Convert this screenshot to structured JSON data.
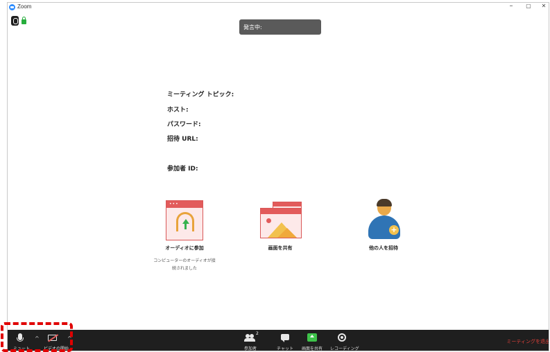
{
  "window": {
    "title": "Zoom"
  },
  "window_controls": {
    "minimize": "–",
    "restore": "▢",
    "close": "✕"
  },
  "notice": {
    "speaking": "発言中:"
  },
  "meeting_info": {
    "topic_label": "ミーティング トピック:",
    "host_label": "ホスト:",
    "password_label": "パスワード:",
    "invite_url_label": "招待 URL:",
    "participant_id_label": "参加者 ID:"
  },
  "actions": {
    "join_audio": {
      "label": "オーディオに参加",
      "status": "コンピューターのオーディオが接続されました"
    },
    "share_screen": {
      "label": "画面を共有"
    },
    "invite": {
      "label": "他の人を招待"
    }
  },
  "toolbar": {
    "mute": "ミュート",
    "start_video": "ビデオの開始",
    "participants": "参加者",
    "participants_count": "2",
    "chat": "チャット",
    "share_screen": "画面を共有",
    "recording": "レコーディング",
    "leave": "ミーティングを退出",
    "caret": "^"
  },
  "colors": {
    "toolbar_bg": "#1f1f1f",
    "accent_red": "#e25b5b",
    "share_green": "#3ec24a",
    "leave_red": "#e0403a",
    "highlight": "#e00000"
  }
}
